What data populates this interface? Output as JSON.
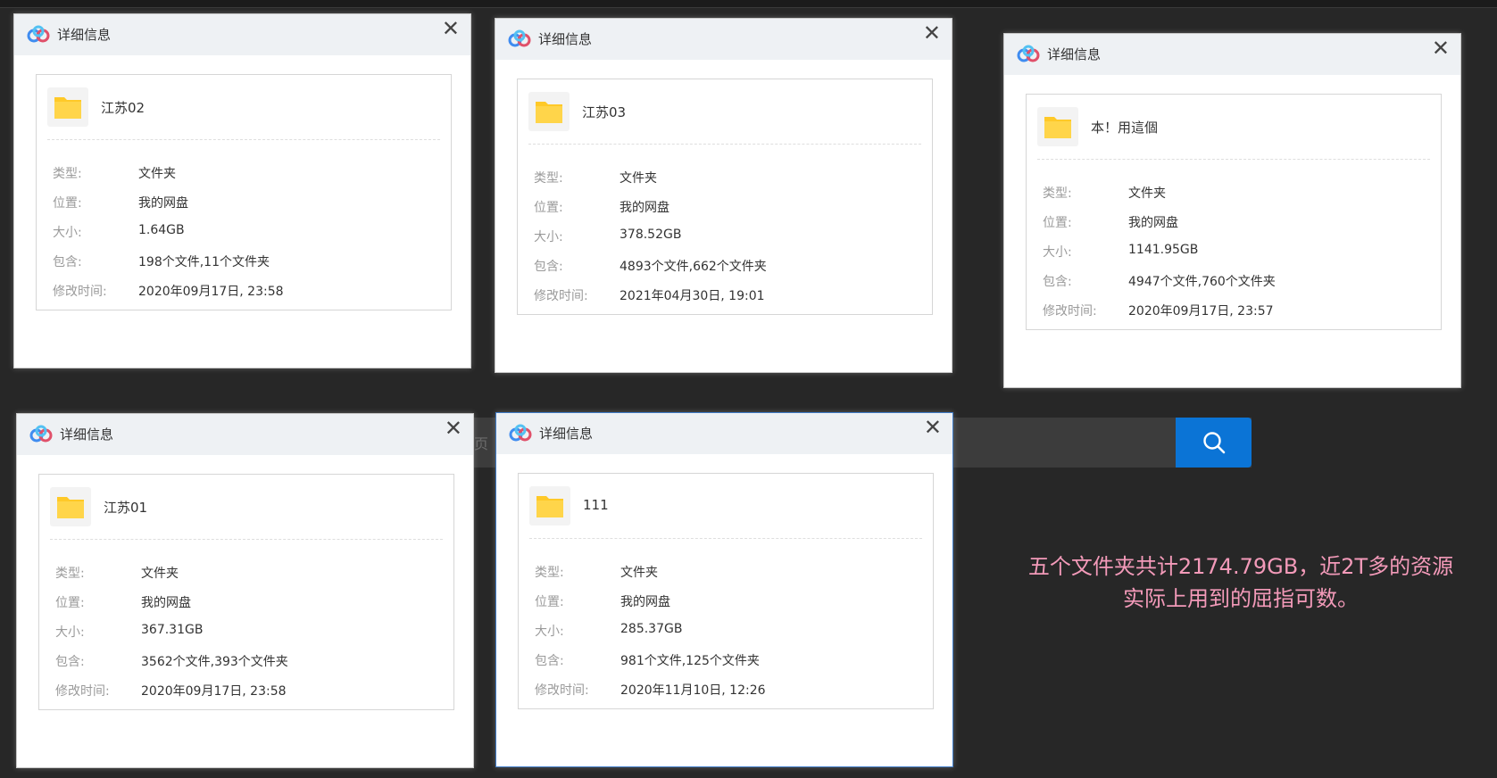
{
  "search": {
    "hint": "页"
  },
  "dialogs": [
    {
      "title": "详细信息",
      "name": "江苏02",
      "type": "文件夹",
      "location": "我的网盘",
      "size": "1.64GB",
      "contains": "198个文件,11个文件夹",
      "modified": "2020年09月17日, 23:58"
    },
    {
      "title": "详细信息",
      "name": "江苏03",
      "type": "文件夹",
      "location": "我的网盘",
      "size": "378.52GB",
      "contains": "4893个文件,662个文件夹",
      "modified": "2021年04月30日, 19:01"
    },
    {
      "title": "详细信息",
      "name": "本！用這個",
      "type": "文件夹",
      "location": "我的网盘",
      "size": "1141.95GB",
      "contains": "4947个文件,760个文件夹",
      "modified": "2020年09月17日, 23:57"
    },
    {
      "title": "详细信息",
      "name": "江苏01",
      "type": "文件夹",
      "location": "我的网盘",
      "size": "367.31GB",
      "contains": "3562个文件,393个文件夹",
      "modified": "2020年09月17日, 23:58"
    },
    {
      "title": "详细信息",
      "name": "111",
      "type": "文件夹",
      "location": "我的网盘",
      "size": "285.37GB",
      "contains": "981个文件,125个文件夹",
      "modified": "2020年11月10日, 12:26"
    }
  ],
  "labels": {
    "type": "类型:",
    "location": "位置:",
    "size": "大小:",
    "contains": "包含:",
    "modified": "修改时间:"
  },
  "close_glyph": "✕",
  "note": {
    "line1": "五个文件夹共计2174.79GB，近2T多的资源",
    "line2": "实际上用到的屈指可数。"
  },
  "colors": {
    "accent": "#0b74d6",
    "note": "#f39ab9",
    "folder": "#ffc928"
  },
  "icons": {
    "logo": "cloud-logo-icon",
    "folder": "folder-icon",
    "close": "close-icon",
    "search": "search-icon"
  }
}
